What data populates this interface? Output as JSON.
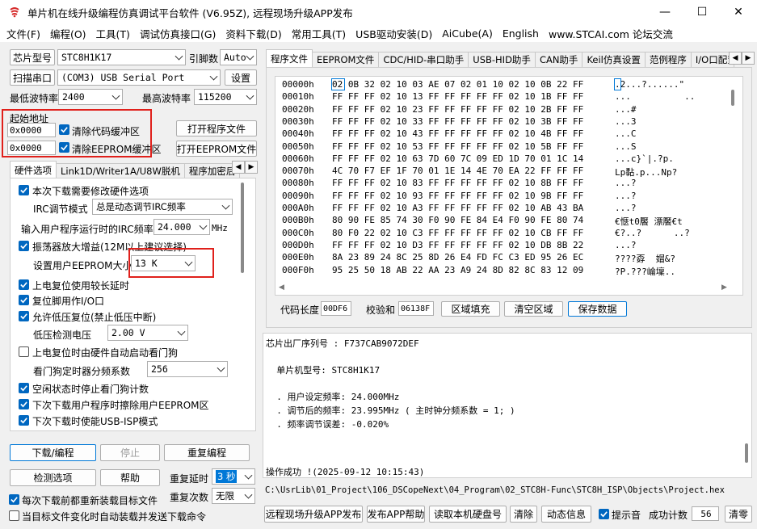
{
  "window": {
    "title": "单片机在线升级编程仿真调试平台软件 (V6.95Z), 远程现场升级APP发布",
    "minimize_glyph": "—",
    "maximize_glyph": "☐",
    "close_glyph": "✕"
  },
  "menu": [
    "文件(F)",
    "编程(O)",
    "工具(T)",
    "调试仿真接口(G)",
    "资料下载(D)",
    "常用工具(T)",
    "USB驱动安装(D)",
    "AiCube(A)",
    "English",
    "www.STCAI.com 论坛交流"
  ],
  "left": {
    "chip_type_label": "芯片型号",
    "chip_type_value": "STC8H1K17",
    "pin_count_label": "引脚数",
    "pin_count_value": "Auto",
    "scan_port_button": "扫描串口",
    "port_value": "(COM3) USB Serial Port",
    "settings_button": "设置",
    "min_baud_label": "最低波特率",
    "min_baud_value": "2400",
    "max_baud_label": "最高波特率",
    "max_baud_value": "115200",
    "start_addr_label": "起始地址",
    "code_addr": "0x0000",
    "clear_code_label": "清除代码缓冲区",
    "eeprom_addr": "0x0000",
    "clear_eeprom_label": "清除EEPROM缓冲区",
    "open_program_button": "打开程序文件",
    "open_eeprom_button": "打开EEPROM文件",
    "tabs": [
      "硬件选项",
      "Link1D/Writer1A/U8W脱机",
      "程序加密后"
    ],
    "tab_prev": "◀",
    "tab_next": "▶",
    "options": {
      "modify_hw_label": "本次下载需要修改硬件选项",
      "irc_mode_label": "IRC调节模式",
      "irc_mode_value": "总是动态调节IRC频率",
      "irc_freq_label": "输入用户程序运行时的IRC频率",
      "irc_freq_value": "24.000",
      "irc_freq_unit": "MHz",
      "osc_gain_label": "振荡器放大增益(12M以上建议选择)",
      "eeprom_size_label": "设置用户EEPROM大小",
      "eeprom_size_value": "13   K",
      "power_reset_label": "上电复位使用较长延时",
      "reset_pin_label": "复位脚用作I/O口",
      "lvr_label": "允许低压复位(禁止低压中断)",
      "lvd_label": "低压检测电压",
      "lvd_value": "2.00 V",
      "wdt_auto_label": "上电复位时由硬件自动启动看门狗",
      "wdt_prescale_label": "看门狗定时器分频系数",
      "wdt_prescale_value": "256",
      "idle_wdt_label": "空闲状态时停止看门狗计数",
      "erase_eeprom_label": "下次下载用户程序时擦除用户EEPROM区",
      "usb_isp_label": "下次下载时使能USB-ISP模式"
    },
    "download_button": "下载/编程",
    "stop_button": "停止",
    "reprogram_button": "重复编程",
    "check_button": "检测选项",
    "help_button": "帮助",
    "repeat_delay_label": "重复延时",
    "repeat_delay_value": "3 秒",
    "repeat_count_label": "重复次数",
    "repeat_count_value": "无限",
    "reload_label": "每次下载前都重新装载目标文件",
    "auto_load_label": "当目标文件变化时自动装载并发送下载命令"
  },
  "right": {
    "tabs": [
      "程序文件",
      "EEPROM文件",
      "CDC/HID-串口助手",
      "USB-HID助手",
      "CAN助手",
      "Keil仿真设置",
      "范例程序",
      "I/O口配置"
    ],
    "tab_prev": "◀",
    "tab_next": "▶",
    "hex": [
      {
        "addr": "00000h",
        "bytes": "02 0B 32 02 10 03 AE 07 02 01 10 02 10 0B 22 FF",
        "ascii": ".2...?......\""
      },
      {
        "addr": "00010h",
        "bytes": "FF FF FF 02 10 13 FF FF FF FF FF 02 10 1B FF FF",
        "ascii": "...          .."
      },
      {
        "addr": "00020h",
        "bytes": "FF FF FF 02 10 23 FF FF FF FF FF 02 10 2B FF FF",
        "ascii": "...#"
      },
      {
        "addr": "00030h",
        "bytes": "FF FF FF 02 10 33 FF FF FF FF FF 02 10 3B FF FF",
        "ascii": "...3"
      },
      {
        "addr": "00040h",
        "bytes": "FF FF FF 02 10 43 FF FF FF FF FF 02 10 4B FF FF",
        "ascii": "...C"
      },
      {
        "addr": "00050h",
        "bytes": "FF FF FF 02 10 53 FF FF FF FF FF 02 10 5B FF FF",
        "ascii": "...S"
      },
      {
        "addr": "00060h",
        "bytes": "FF FF FF 02 10 63 7D 60 7C 09 ED 1D 70 01 1C 14",
        "ascii": "...c}`|.?p."
      },
      {
        "addr": "00070h",
        "bytes": "4C 70 F7 EF 1F 70 01 1E 14 4E 70 EA 22 FF FF FF",
        "ascii": "Lp黏.p...Np?"
      },
      {
        "addr": "00080h",
        "bytes": "FF FF FF 02 10 83 FF FF FF FF FF 02 10 8B FF FF",
        "ascii": "...?"
      },
      {
        "addr": "00090h",
        "bytes": "FF FF FF 02 10 93 FF FF FF FF FF 02 10 9B FF FF",
        "ascii": "...?"
      },
      {
        "addr": "000A0h",
        "bytes": "FF FF FF 02 10 A3 FF FF FF FF FF 02 10 AB 43 BA",
        "ascii": "...?"
      },
      {
        "addr": "000B0h",
        "bytes": "80 90 FE 85 74 30 F0 90 FE 84 E4 F0 90 FE 80 74",
        "ascii": "€愜t0饜 漂饜€t"
      },
      {
        "addr": "000C0h",
        "bytes": "80 F0 22 02 10 C3 FF FF FF FF FF 02 10 CB FF FF",
        "ascii": "€?..?      ..?"
      },
      {
        "addr": "000D0h",
        "bytes": "FF FF FF 02 10 D3 FF FF FF FF FF 02 10 DB 8B 22",
        "ascii": "...?"
      },
      {
        "addr": "000E0h",
        "bytes": "8A 23 89 24 8C 25 8D 26 E4 FD FC C3 ED 95 26 EC",
        "ascii": "????孬  媢&?"
      },
      {
        "addr": "000F0h",
        "bytes": "95 25 50 18 AB 22 AA 23 A9 24 8D 82 8C 83 12 09",
        "ascii": "?P.???崘壈.."
      }
    ],
    "code_length_label": "代码长度",
    "code_length_value": "00DF6",
    "checksum_label": "校验和",
    "checksum_value": "06138F",
    "fill_button": "区域填充",
    "clear_area_button": "清空区域",
    "save_button": "保存数据",
    "log": [
      "芯片出厂序列号 : F737CAB9072DEF",
      "",
      "  单片机型号: STC8H1K17",
      "",
      "  . 用户设定频率: 24.000MHz",
      "  . 调节后的频率: 23.995MHz ( 主时钟分频系数 = 1; )",
      "  . 频率调节误差: -0.020%",
      "",
      "",
      "操作成功 !(2025-09-12 10:15:43)"
    ],
    "file_path": "C:\\UsrLib\\01_Project\\106_DSCopeNext\\04_Program\\02_STC8H-Func\\STC8H_ISP\\Objects\\Project.hex",
    "remote_publish_button": "远程现场升级APP发布",
    "publish_help_button": "发布APP帮助",
    "read_disk_button": "读取本机硬盘号",
    "clear_button": "清除",
    "dynamic_info_button": "动态信息",
    "beep_label": "提示音",
    "success_count_label": "成功计数",
    "success_count_value": "56",
    "clear_zero_button": "清零"
  }
}
